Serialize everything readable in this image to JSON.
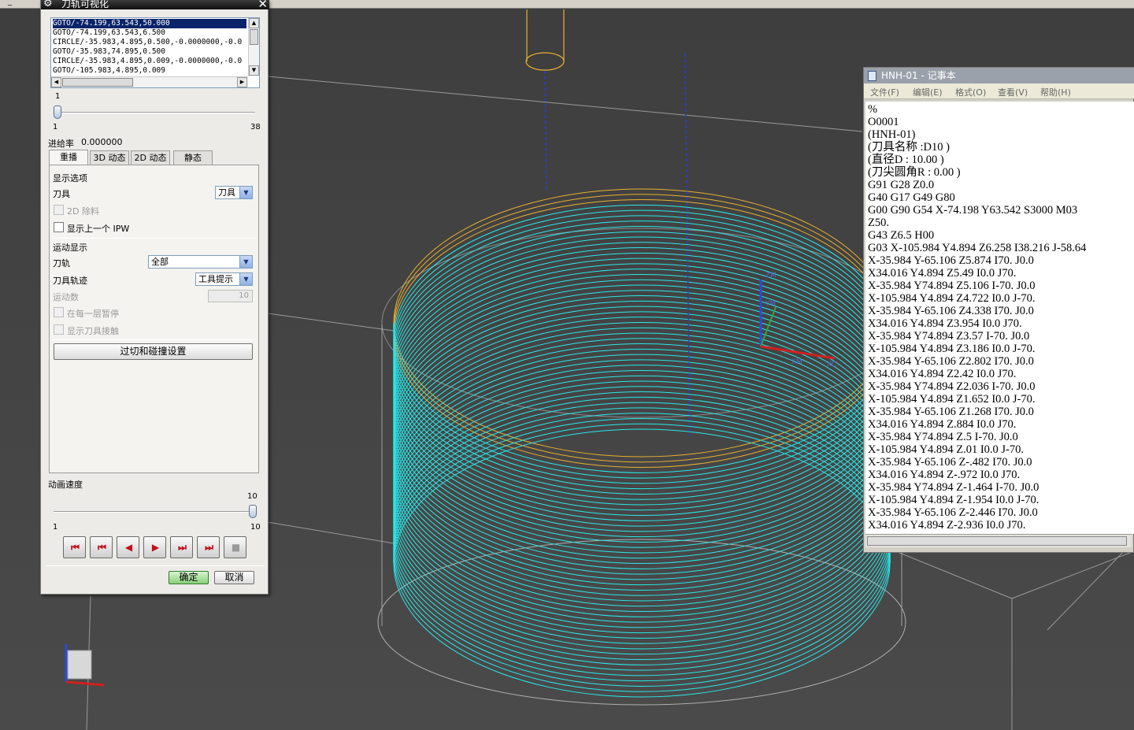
{
  "topbar": {
    "title": "_"
  },
  "dialog": {
    "title": "刀轨可视化",
    "close_icon": "close-icon",
    "gear_icon": "gear-icon",
    "cl_lines": [
      "GOTO/-74.199,63.543,50.000",
      "GOTO/-74.199,63.543,6.500",
      "CIRCLE/-35.983,4.895,0.500,-0.0000000,-0.0",
      "GOTO/-35.983,74.895,0.500",
      "CIRCLE/-35.983,4.895,0.009,-0.0000000,-0.0",
      "GOTO/-105.983,4.895,0.009"
    ],
    "selected_line": 0,
    "motion_slider": {
      "value": "1",
      "min": "1",
      "max": "38",
      "fraction": 0.0
    },
    "feedrate_label": "进给率",
    "feedrate_value": "0.000000",
    "tabs": [
      "重播",
      "3D 动态",
      "2D 动态",
      "静态"
    ],
    "active_tab": 0,
    "display_options": {
      "heading": "显示选项",
      "tool_label": "刀具",
      "tool_value": "刀具",
      "remove_2d": "2D 除料",
      "show_prev_ipw": "显示上一个 IPW"
    },
    "motion_display": {
      "heading": "运动显示",
      "path_label": "刀轨",
      "path_value": "全部",
      "trace_label": "刀具轨迹",
      "trace_value": "工具提示",
      "count_label": "运动数",
      "count_value": "10",
      "pause_each_layer": "在每一层暂停",
      "show_contact": "显示刀具接触"
    },
    "gouge_button": "过切和碰撞设置",
    "anim_speed": {
      "label": "动画速度",
      "value": "10",
      "min": "1",
      "max": "10",
      "fraction": 1.0
    },
    "playback": {
      "first": "⏮",
      "prev_step": "⏮",
      "back": "◀",
      "play": "▶",
      "next_step": "⏭",
      "last": "⏭",
      "stop": "■"
    },
    "ok": "确定",
    "cancel": "取消"
  },
  "notepad": {
    "title": "HNH-01 - 记事本",
    "menu": [
      "文件(F)",
      "编辑(E)",
      "格式(O)",
      "查看(V)",
      "帮助(H)"
    ],
    "lines": [
      "%",
      "O0001",
      "(HNH-01)",
      "(刀具名称 :D10 )",
      "(直径D : 10.00  )",
      "(刀尖圆角R : 0.00  )",
      "G91 G28 Z0.0",
      "G40 G17 G49 G80",
      "G00 G90 G54 X-74.198 Y63.542 S3000 M03",
      "Z50.",
      "G43 Z6.5 H00",
      "G03 X-105.984 Y4.894 Z6.258 I38.216 J-58.64",
      "X-35.984 Y-65.106 Z5.874 I70. J0.0",
      "X34.016 Y4.894 Z5.49 I0.0 J70.",
      "X-35.984 Y74.894 Z5.106 I-70. J0.0",
      "X-105.984 Y4.894 Z4.722 I0.0 J-70.",
      "X-35.984 Y-65.106 Z4.338 I70. J0.0",
      "X34.016 Y4.894 Z3.954 I0.0 J70.",
      "X-35.984 Y74.894 Z3.57 I-70. J0.0",
      "X-105.984 Y4.894 Z3.186 I0.0 J-70.",
      "X-35.984 Y-65.106 Z2.802 I70. J0.0",
      "X34.016 Y4.894 Z2.42 I0.0 J70.",
      "X-35.984 Y74.894 Z2.036 I-70. J0.0",
      "X-105.984 Y4.894 Z1.652 I0.0 J-70.",
      "X-35.984 Y-65.106 Z1.268 I70. J0.0",
      "X34.016 Y4.894 Z.884 I0.0 J70.",
      "X-35.984 Y74.894 Z.5 I-70. J0.0",
      "X-105.984 Y4.894 Z.01 I0.0 J-70.",
      "X-35.984 Y-65.106 Z-.482 I70. J0.0",
      "X34.016 Y4.894 Z-.972 I0.0 J70.",
      "X-35.984 Y74.894 Z-1.464 I-70. J0.0",
      "X-105.984 Y4.894 Z-1.954 I0.0 J-70.",
      "X-35.984 Y-65.106 Z-2.446 I70. J0.0",
      "X34.016 Y4.894 Z-2.936 I0.0 J70."
    ]
  },
  "viewport": {
    "toolpath_color": "#29e8ea",
    "highlight_color": "#e8b030",
    "triad_labels": [
      "ZM",
      "YM",
      "XM",
      "XC"
    ]
  }
}
